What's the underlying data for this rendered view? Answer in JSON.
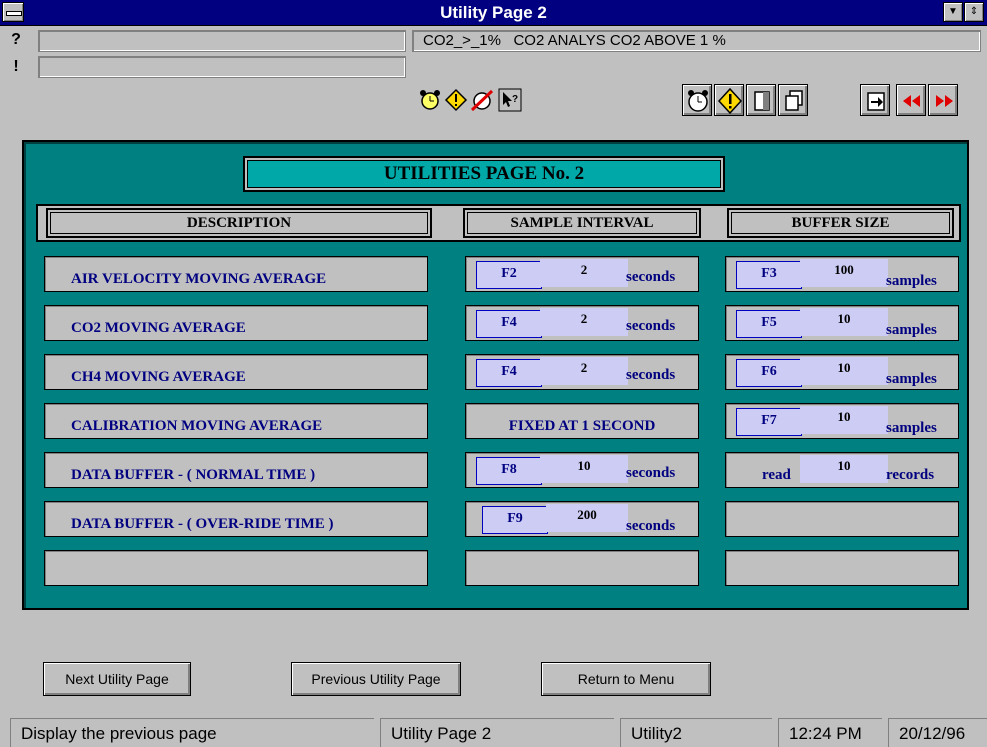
{
  "window": {
    "title": "Utility Page 2"
  },
  "alarm": {
    "message": "CO2_>_1%   CO2 ANALYS CO2 ABOVE 1 %"
  },
  "msg_rows": {
    "help_icon": "?",
    "warn_icon": "!"
  },
  "panel": {
    "heading": "UTILITIES PAGE No. 2",
    "columns": {
      "description": "DESCRIPTION",
      "interval": "SAMPLE INTERVAL",
      "buffer": "BUFFER SIZE"
    },
    "rows": [
      {
        "description": "AIR VELOCITY MOVING AVERAGE",
        "interval_key": "F2",
        "interval_value": "2",
        "interval_unit": "seconds",
        "buffer_key": "F3",
        "buffer_value": "100",
        "buffer_unit": "samples"
      },
      {
        "description": "CO2 MOVING AVERAGE",
        "interval_key": "F4",
        "interval_value": "2",
        "interval_unit": "seconds",
        "buffer_key": "F5",
        "buffer_value": "10",
        "buffer_unit": "samples"
      },
      {
        "description": "CH4 MOVING AVERAGE",
        "interval_key": "F4",
        "interval_value": "2",
        "interval_unit": "seconds",
        "buffer_key": "F6",
        "buffer_value": "10",
        "buffer_unit": "samples"
      },
      {
        "description": "CALIBRATION MOVING AVERAGE",
        "interval_fixed": "FIXED AT 1 SECOND",
        "buffer_key": "F7",
        "buffer_value": "10",
        "buffer_unit": "samples"
      },
      {
        "description": "DATA BUFFER -  ( NORMAL TIME )",
        "interval_key": "F8",
        "interval_value": "10",
        "interval_unit": "seconds",
        "buffer_prefix": "read",
        "buffer_value": "10",
        "buffer_unit": "records"
      },
      {
        "description": "DATA BUFFER - ( OVER-RIDE TIME )",
        "interval_key": "F9",
        "interval_value": "200",
        "interval_unit": "seconds"
      }
    ]
  },
  "buttons": {
    "next": "Next Utility Page",
    "previous": "Previous Utility Page",
    "menu": "Return to Menu"
  },
  "status": {
    "hint": "Display the previous page",
    "page": "Utility Page 2",
    "screen": "Utility2",
    "time": "12:24 PM",
    "date": "20/12/96"
  },
  "icons": [
    "system-menu-icon",
    "alarm-clock-icon",
    "warning-icon",
    "no-alarm-icon",
    "help-pointer-icon",
    "clock-icon",
    "acknowledge-icon",
    "page-icon",
    "copy-icon",
    "export-icon",
    "rewind-icon",
    "fast-forward-icon"
  ],
  "colors": {
    "title_bar": "#000080",
    "panel": "#008080",
    "heading": "#00a8a8",
    "value_box": "#ccccf4",
    "label_text": "#000080"
  }
}
